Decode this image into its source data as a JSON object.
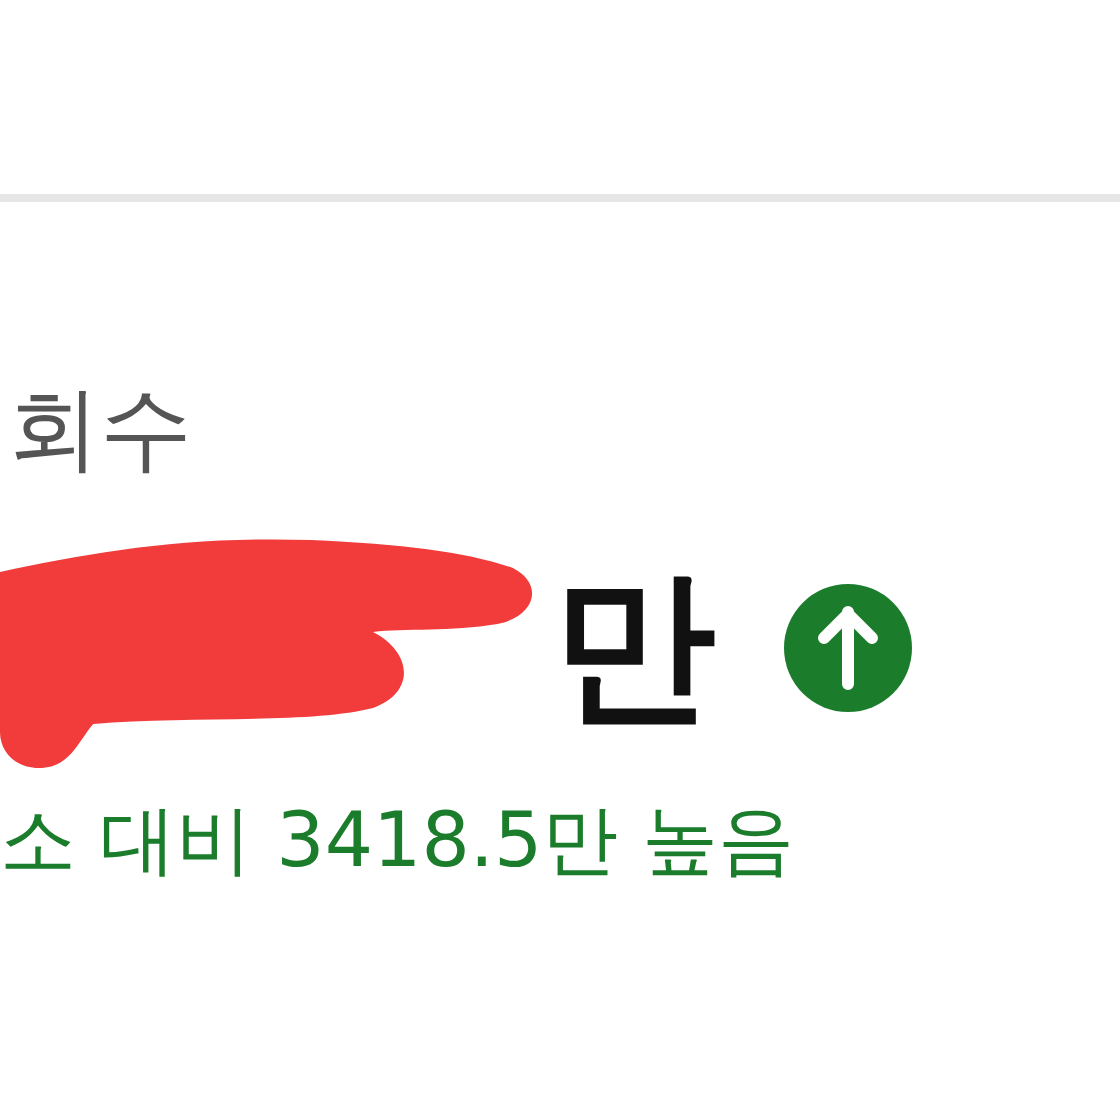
{
  "metric": {
    "label": "회수",
    "value": "만",
    "rising": true,
    "comparison": "소 대비 3418.5만 높음"
  }
}
